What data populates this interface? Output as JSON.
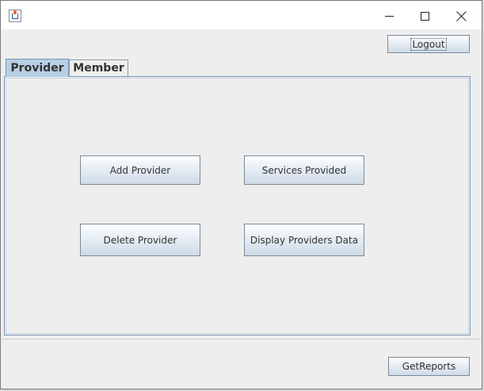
{
  "window": {
    "icon": "java-cup-icon",
    "controls": {
      "minimize": "minimize-icon",
      "maximize": "maximize-icon",
      "close": "close-icon"
    }
  },
  "toolbar": {
    "logout_label": "Logout"
  },
  "tabs": [
    {
      "label": "Provider",
      "selected": true
    },
    {
      "label": "Member",
      "selected": false
    }
  ],
  "provider_panel": {
    "add_provider_label": "Add Provider",
    "services_provided_label": "Services Provided",
    "delete_provider_label": "Delete Provider",
    "display_providers_data_label": "Display Providers Data"
  },
  "footer": {
    "get_reports_label": "GetReports"
  },
  "colors": {
    "selected_tab": "#b8cfe5",
    "button_gradient_top": "#ffffff",
    "button_gradient_bottom": "#cfdbe7",
    "window_background": "#eeeeee"
  }
}
